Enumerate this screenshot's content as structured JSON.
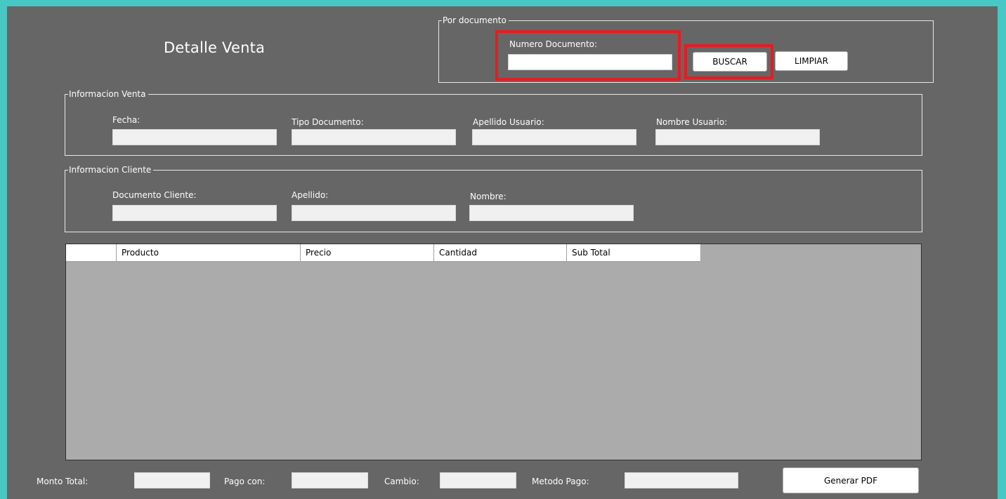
{
  "title": "Detalle Venta",
  "search": {
    "group_label": "Por documento",
    "numero_label": "Numero Documento:",
    "numero_value": "",
    "buscar_label": "BUSCAR",
    "limpiar_label": "LIMPIAR"
  },
  "venta": {
    "group_label": "Informacion Venta",
    "fecha_label": "Fecha:",
    "tipo_label": "Tipo Documento:",
    "apellido_label": "Apellido Usuario:",
    "nombre_label": "Nombre Usuario:"
  },
  "cliente": {
    "group_label": "Informacion Cliente",
    "documento_label": "Documento Cliente:",
    "apellido_label": "Apellido:",
    "nombre_label": "Nombre:"
  },
  "grid": {
    "columns": [
      "",
      "Producto",
      "Precio",
      "Cantidad",
      "Sub Total"
    ],
    "rows": []
  },
  "footer": {
    "monto_label": "Monto Total:",
    "pago_label": "Pago con:",
    "cambio_label": "Cambio:",
    "metodo_label": "Metodo Pago:",
    "pdf_label": "Generar PDF"
  },
  "colors": {
    "window_border": "#48c8c4",
    "form_background": "#666666",
    "highlight": "#e61b23",
    "grid_background": "#ababab"
  }
}
